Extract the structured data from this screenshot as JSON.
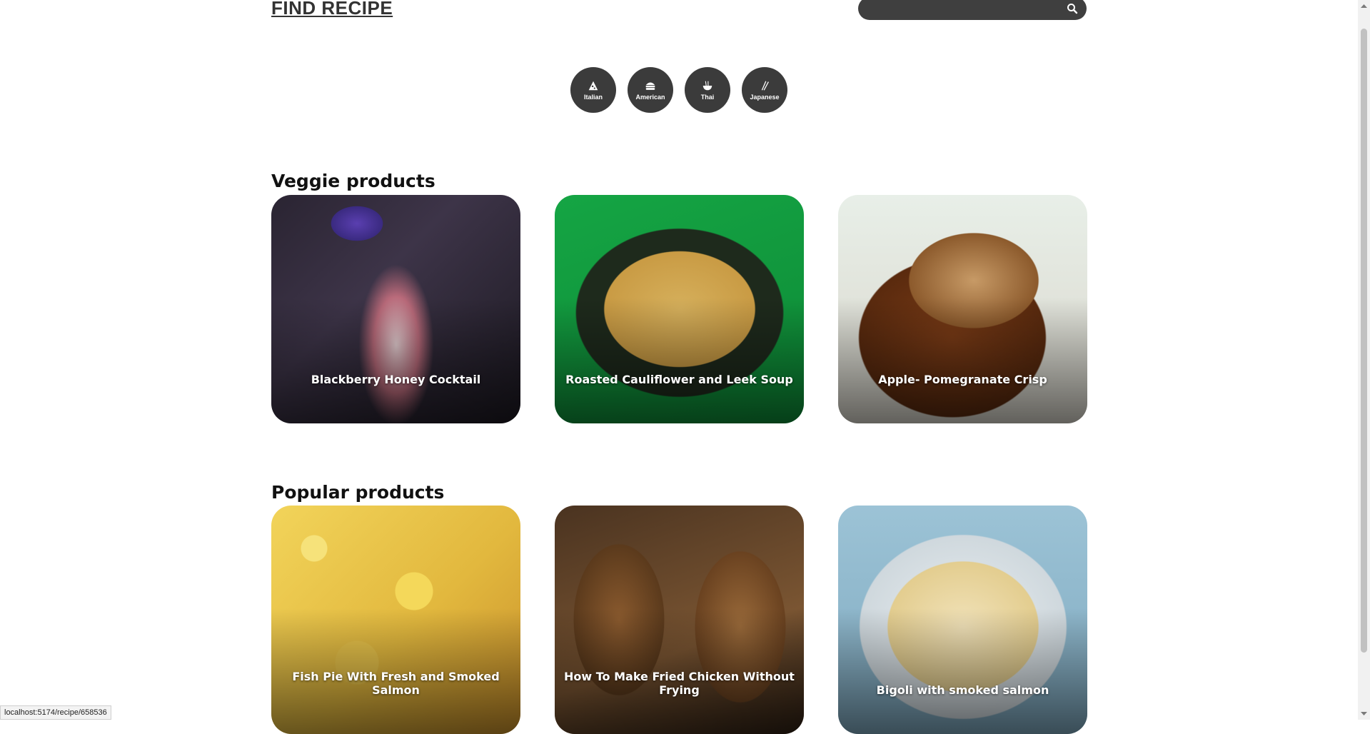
{
  "header": {
    "logo_text": "FIND RECIPE",
    "search": {
      "placeholder": "",
      "value": "",
      "icon": "search-icon"
    }
  },
  "cuisines": [
    {
      "label": "Italian",
      "icon": "pizza-icon"
    },
    {
      "label": "American",
      "icon": "burger-icon"
    },
    {
      "label": "Thai",
      "icon": "noodle-bowl-icon"
    },
    {
      "label": "Japanese",
      "icon": "chopsticks-icon"
    }
  ],
  "veggie": {
    "title": "Veggie products",
    "cards": [
      {
        "title": "Blackberry Honey Cocktail"
      },
      {
        "title": "Roasted Cauliflower and Leek Soup"
      },
      {
        "title": "Apple- Pomegranate Crisp"
      }
    ]
  },
  "popular": {
    "title": "Popular products",
    "cards": [
      {
        "title": "Fish Pie With Fresh and Smoked Salmon"
      },
      {
        "title": "How To Make Fried Chicken Without Frying"
      },
      {
        "title": "Bigoli with smoked salmon"
      }
    ]
  },
  "status_bar": {
    "url": "localhost:5174/recipe/658536"
  },
  "colors": {
    "chip_bg": "#3b3b3b",
    "search_bg": "#3f3f3f",
    "text": "#111111"
  }
}
